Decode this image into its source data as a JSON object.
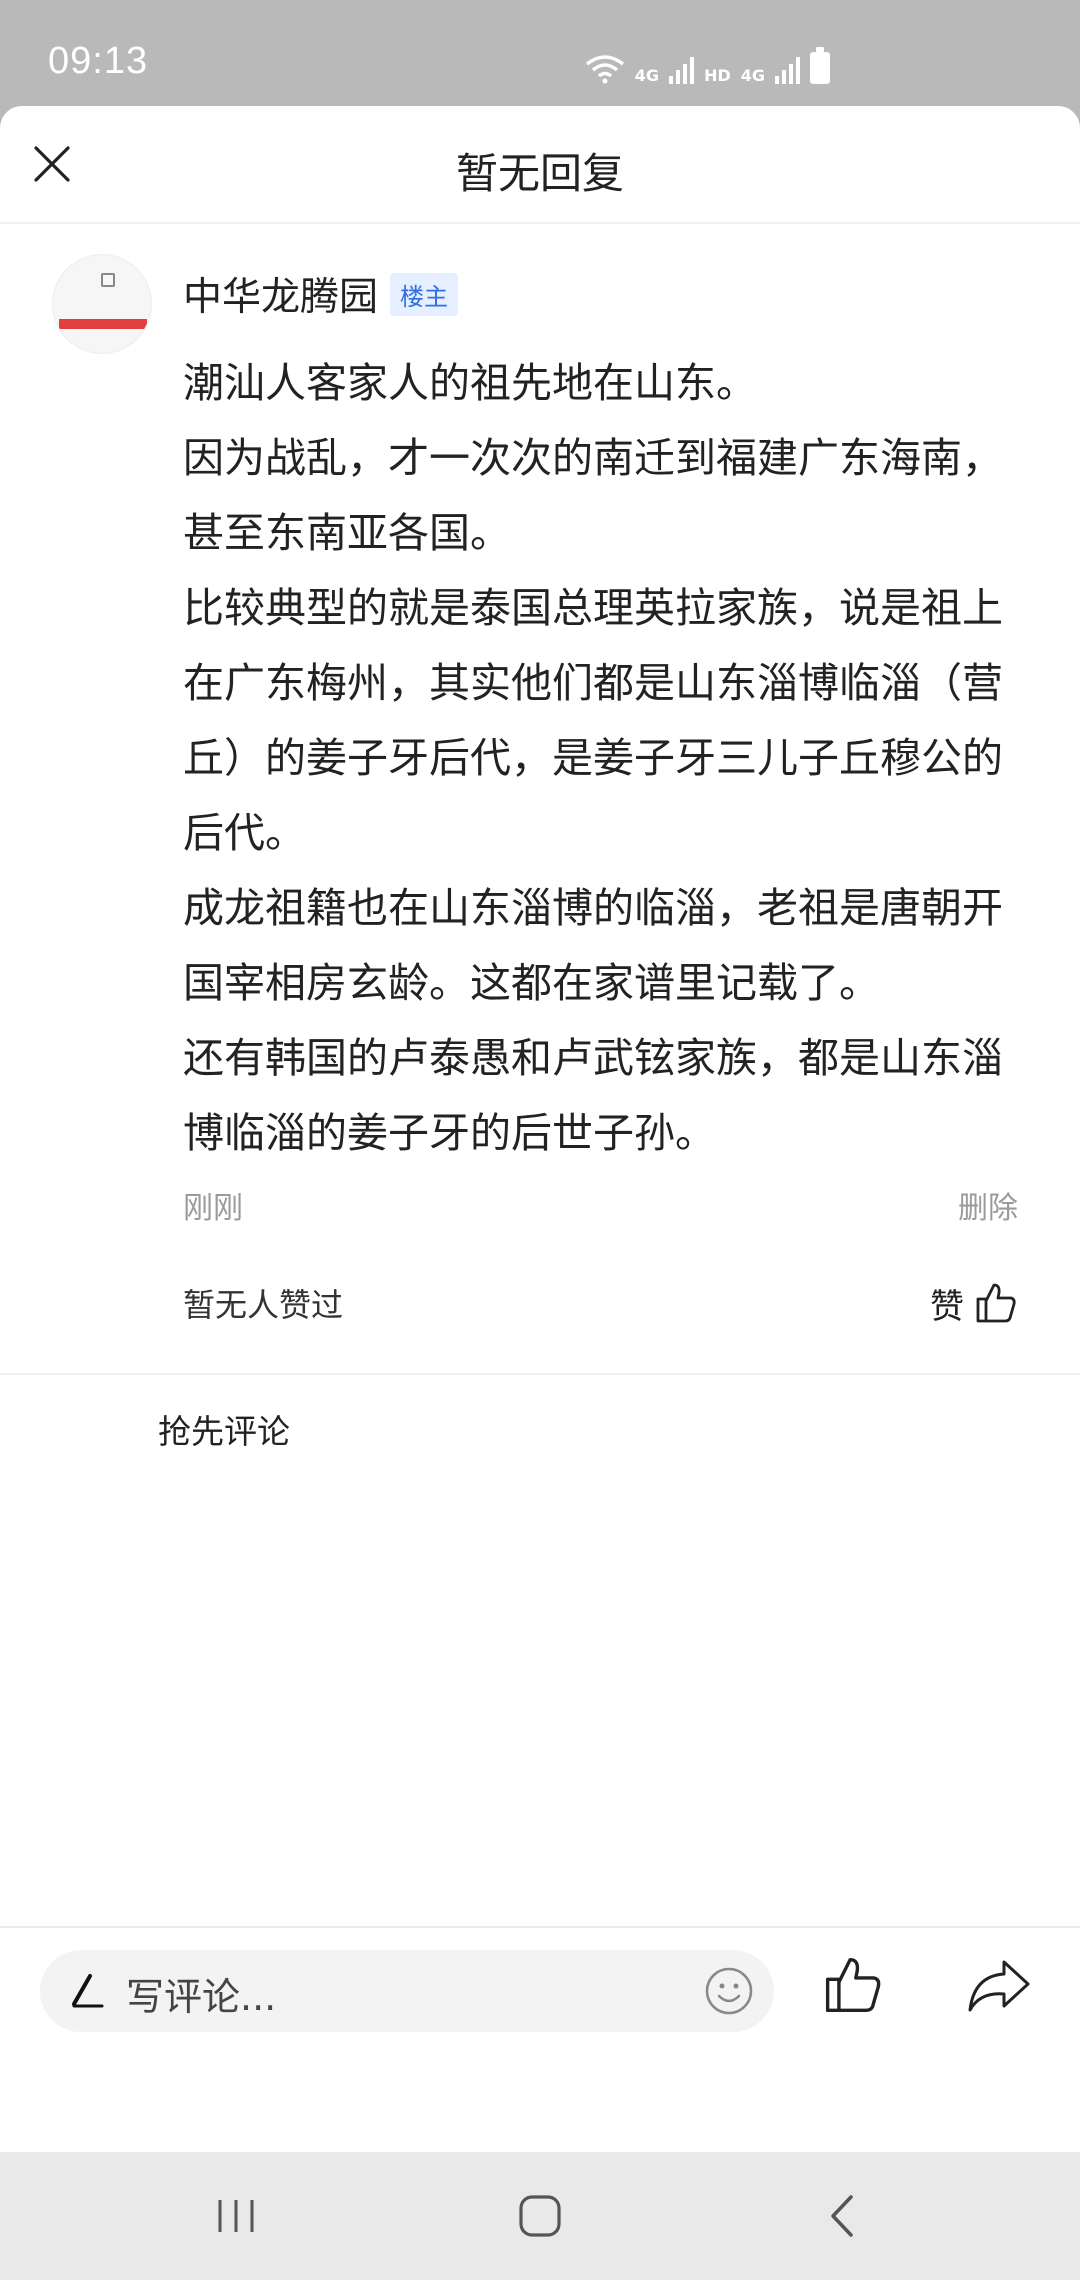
{
  "status_bar": {
    "time": "09:13",
    "network_1": "4G",
    "hd": "HD",
    "network_2": "4G"
  },
  "header": {
    "title": "暂无回复"
  },
  "post": {
    "author": "中华龙腾园",
    "author_tag": "楼主",
    "lines": [
      "潮汕人客家人的祖先地在山东。",
      "因为战乱，才一次次的南迁到福建广东海南，甚至东南亚各国。",
      "比较典型的就是泰国总理英拉家族，说是祖上在广东梅州，其实他们都是山东淄博临淄（营丘）的姜子牙后代，是姜子牙三儿子丘穆公的后代。",
      "成龙祖籍也在山东淄博的临淄，老祖是唐朝开国宰相房玄龄。这都在家谱里记载了。",
      "还有韩国的卢泰愚和卢武铉家族，都是山东淄博临淄的姜子牙的后世子孙。"
    ],
    "time": "刚刚",
    "delete_label": "删除",
    "like_count_text": "暂无人赞过",
    "like_label": "赞"
  },
  "comments": {
    "first_comment_prompt": "抢先评论"
  },
  "comment_bar": {
    "placeholder": "写评论..."
  },
  "colors": {
    "accent": "#2f6fe0",
    "tag_bg": "#e5efff",
    "muted": "#9a9a9a"
  }
}
